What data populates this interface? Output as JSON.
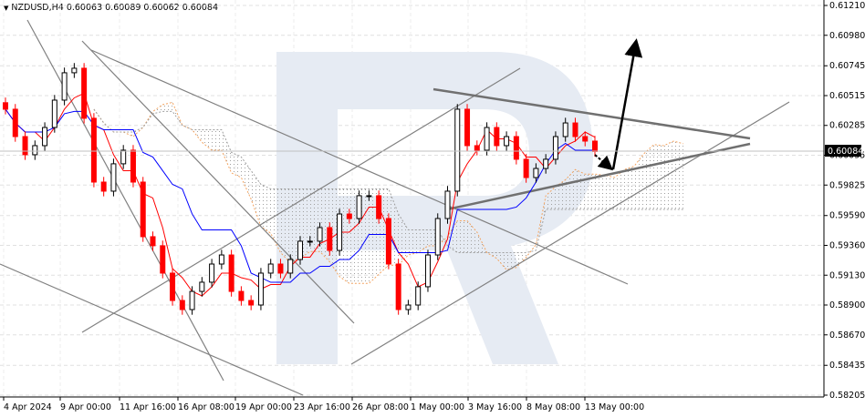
{
  "header": {
    "symbol": "NZDUSD,H4",
    "open": "0.60063",
    "high": "0.60089",
    "low": "0.60062",
    "close": "0.60084"
  },
  "current_price_label": "0.60084",
  "colors": {
    "bull": "#000000",
    "bear": "#ff0000",
    "tenkan": "#ff0000",
    "kijun": "#0000ff",
    "cloud_a": "#a0a0a0",
    "cloud_b": "#f4a460",
    "trend": "#808080",
    "arrow": "#000000",
    "watermark": "#e6ebf3"
  },
  "chart_data": {
    "type": "candlestick",
    "title": "NZDUSD,H4",
    "ylim": [
      0.58205,
      0.6121
    ],
    "y_ticks": [
      "0.61210",
      "0.60980",
      "0.60745",
      "0.60515",
      "0.60285",
      "0.60055",
      "0.59825",
      "0.59590",
      "0.59360",
      "0.59130",
      "0.58900",
      "0.58670",
      "0.58435",
      "0.58205"
    ],
    "x_ticks": [
      "4 Apr 2024",
      "9 Apr 00:00",
      "11 Apr 16:00",
      "16 Apr 08:00",
      "19 Apr 00:00",
      "23 Apr 16:00",
      "26 Apr 08:00",
      "1 May 00:00",
      "3 May 16:00",
      "8 May 08:00",
      "13 May 00:00"
    ],
    "closes": [
      0.6041,
      0.60199,
      0.60059,
      0.60129,
      0.60269,
      0.6048,
      0.60691,
      0.60726,
      0.6034,
      0.59848,
      0.59778,
      0.59989,
      0.60094,
      0.59848,
      0.59427,
      0.59357,
      0.59146,
      0.58935,
      0.58865,
      0.59005,
      0.59076,
      0.59216,
      0.59286,
      0.59005,
      0.58935,
      0.589,
      0.59146,
      0.59216,
      0.59146,
      0.59251,
      0.59392,
      0.59392,
      0.59497,
      0.59321,
      0.59602,
      0.59567,
      0.59743,
      0.59743,
      0.59567,
      0.59216,
      0.58865,
      0.589,
      0.59041,
      0.59286,
      0.59567,
      0.59778,
      0.6041,
      0.60129,
      0.60094,
      0.60269,
      0.60129,
      0.60199,
      0.60024,
      0.59883,
      0.59953,
      0.60024,
      0.60199,
      0.60304,
      0.60199,
      0.60164,
      0.60084
    ],
    "indicators": [
      "Ichimoku Kinko Hyo"
    ]
  }
}
